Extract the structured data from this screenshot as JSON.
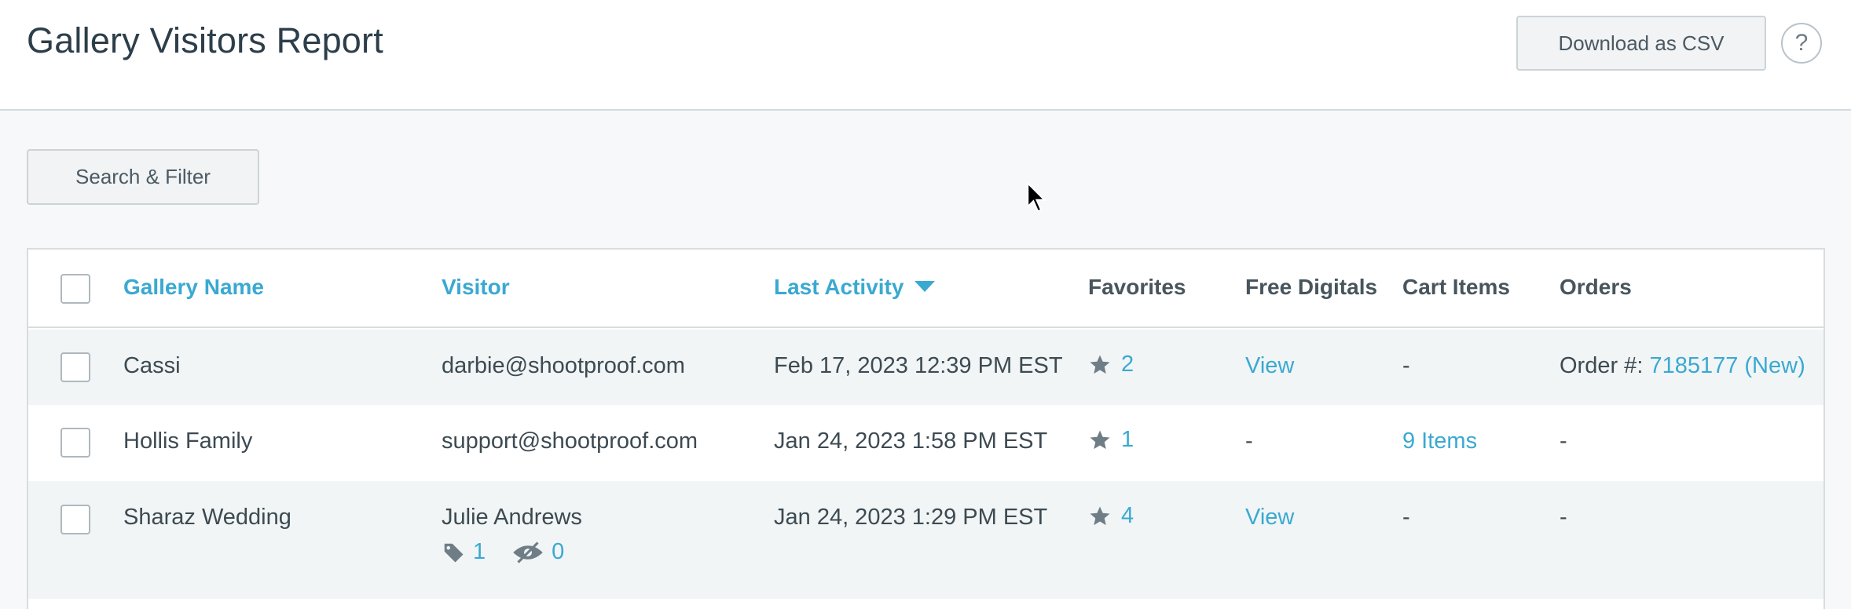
{
  "header": {
    "title": "Gallery Visitors Report",
    "download_label": "Download as CSV",
    "help_label": "?"
  },
  "toolbar": {
    "filter_label": "Search & Filter"
  },
  "table": {
    "columns": {
      "gallery_name": "Gallery Name",
      "visitor": "Visitor",
      "last_activity": "Last Activity",
      "favorites": "Favorites",
      "free_digitals": "Free Digitals",
      "cart_items": "Cart Items",
      "orders": "Orders"
    },
    "rows": [
      {
        "gallery": "Cassi",
        "visitor": "darbie@shootproof.com",
        "last_activity": "Feb 17, 2023 12:39 PM EST",
        "favorites": "2",
        "free_digitals": "View",
        "cart_items": "-",
        "orders_prefix": "Order #: ",
        "orders_link": "7185177 (New)"
      },
      {
        "gallery": "Hollis Family",
        "visitor": "support@shootproof.com",
        "last_activity": "Jan 24, 2023 1:58 PM EST",
        "favorites": "1",
        "free_digitals": "-",
        "cart_items": "9 Items",
        "orders": "-"
      },
      {
        "gallery": "Sharaz Wedding",
        "visitor": "Julie Andrews",
        "visitor_tags": "1",
        "visitor_hidden": "0",
        "last_activity": "Jan 24, 2023 1:29 PM EST",
        "favorites": "4",
        "free_digitals": "View",
        "cart_items": "-",
        "orders": "-"
      }
    ]
  },
  "colors": {
    "accent": "#3aa9d1",
    "icon": "#6f7d86",
    "title": "#2c3e4a"
  }
}
